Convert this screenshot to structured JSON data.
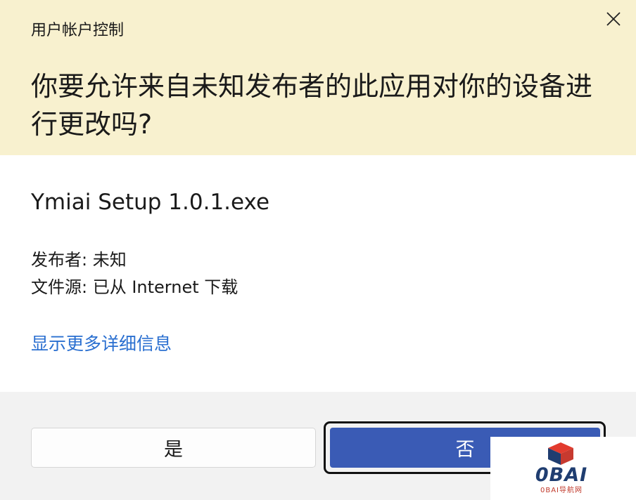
{
  "window": {
    "title": "用户帐户控制",
    "close_icon": "close-icon"
  },
  "prompt": {
    "question": "你要允许来自未知发布者的此应用对你的设备进行更改吗?"
  },
  "program": {
    "name": "Ymiai Setup 1.0.1.exe",
    "publisher_line": "发布者: 未知",
    "origin_line": "文件源: 已从 Internet 下载"
  },
  "details_link": "显示更多详细信息",
  "buttons": {
    "yes": "是",
    "no": "否"
  },
  "watermark": {
    "logo_icon": "cube-logo-icon",
    "brand": "0BAI",
    "subtitle": "0BAI导航网"
  },
  "colors": {
    "header_bg": "#f8f1cf",
    "link": "#2a6fd0",
    "primary_button": "#3a5bb5",
    "footer_bg": "#f2f2f2"
  }
}
